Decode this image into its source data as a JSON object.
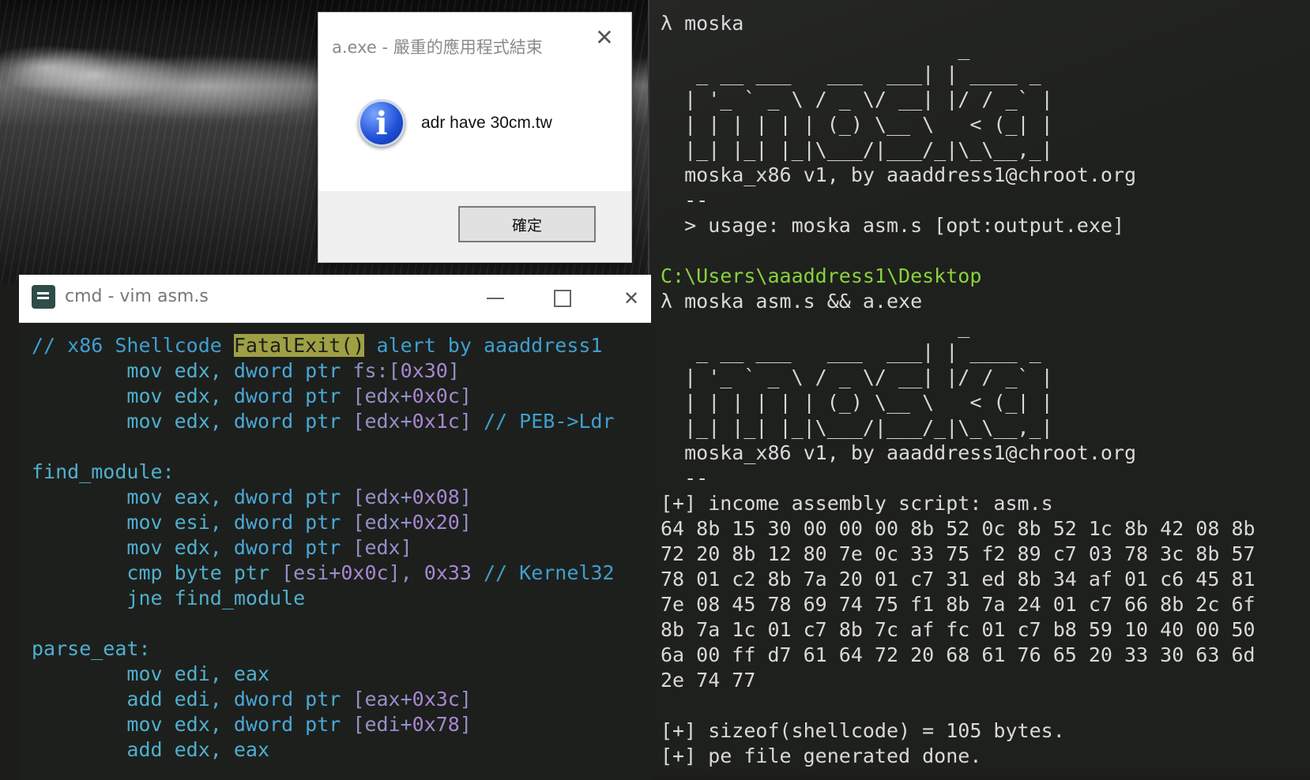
{
  "msgbox": {
    "title": "a.exe - 嚴重的應用程式結束",
    "close_label": "✕",
    "message": "adr have 30cm.tw",
    "ok_label": "確定",
    "icon": "info-icon"
  },
  "vim": {
    "title": "cmd - vim  asm.s",
    "lines": [
      {
        "parts": [
          [
            "c-cmt",
            "// x86 Shellcode "
          ],
          [
            "c-hl",
            "FatalExit()"
          ],
          [
            "c-cmt",
            " alert by aaaddress1"
          ]
        ]
      },
      {
        "parts": [
          [
            "",
            "        mov edx, "
          ],
          [
            "c-kw",
            "dword ptr"
          ],
          [
            "",
            "",
            " "
          ],
          [
            "c-br",
            " fs:["
          ],
          [
            "c-num",
            "0x30"
          ],
          [
            "c-br",
            "]"
          ]
        ]
      },
      {
        "parts": [
          [
            "",
            "        mov edx, "
          ],
          [
            "c-kw",
            "dword ptr "
          ],
          [
            "c-br",
            "[edx+"
          ],
          [
            "c-num",
            "0x0c"
          ],
          [
            "c-br",
            "]"
          ]
        ]
      },
      {
        "parts": [
          [
            "",
            "        mov edx, "
          ],
          [
            "c-kw",
            "dword ptr "
          ],
          [
            "c-br",
            "[edx+"
          ],
          [
            "c-num",
            "0x1c"
          ],
          [
            "c-br",
            "]"
          ],
          [
            "c-cmt",
            " // PEB->Ldr"
          ]
        ]
      },
      {
        "parts": [
          [
            "",
            ""
          ]
        ]
      },
      {
        "parts": [
          [
            "",
            "find_module:"
          ]
        ]
      },
      {
        "parts": [
          [
            "",
            "        mov eax, "
          ],
          [
            "c-kw",
            "dword ptr "
          ],
          [
            "c-br",
            "[edx+"
          ],
          [
            "c-num",
            "0x08"
          ],
          [
            "c-br",
            "]"
          ]
        ]
      },
      {
        "parts": [
          [
            "",
            "        mov esi, "
          ],
          [
            "c-kw",
            "dword ptr "
          ],
          [
            "c-br",
            "[edx+"
          ],
          [
            "c-num",
            "0x20"
          ],
          [
            "c-br",
            "]"
          ]
        ]
      },
      {
        "parts": [
          [
            "",
            "        mov edx, "
          ],
          [
            "c-kw",
            "dword ptr "
          ],
          [
            "c-br",
            "[edx]"
          ]
        ]
      },
      {
        "parts": [
          [
            "",
            "        cmp byte ptr "
          ],
          [
            "c-br",
            "[esi+"
          ],
          [
            "c-num",
            "0x0c"
          ],
          [
            "c-br",
            "], "
          ],
          [
            "c-num",
            "0x33"
          ],
          [
            "c-cmt",
            " // Kernel32"
          ]
        ]
      },
      {
        "parts": [
          [
            "",
            "        jne find_module"
          ]
        ]
      },
      {
        "parts": [
          [
            "",
            ""
          ]
        ]
      },
      {
        "parts": [
          [
            "",
            "parse_eat:"
          ]
        ]
      },
      {
        "parts": [
          [
            "",
            "        mov edi, eax"
          ]
        ]
      },
      {
        "parts": [
          [
            "",
            "        add edi, "
          ],
          [
            "c-kw",
            "dword ptr "
          ],
          [
            "c-br",
            "[eax+"
          ],
          [
            "c-num",
            "0x3c"
          ],
          [
            "c-br",
            "]"
          ]
        ]
      },
      {
        "parts": [
          [
            "",
            "        mov edx, "
          ],
          [
            "c-kw",
            "dword ptr "
          ],
          [
            "c-br",
            "[edi+"
          ],
          [
            "c-num",
            "0x78"
          ],
          [
            "c-br",
            "]"
          ]
        ]
      },
      {
        "parts": [
          [
            "",
            "        add edx, eax"
          ]
        ]
      }
    ]
  },
  "terminal": {
    "prompt1": "λ moska",
    "ascii_logo": "                         _\n   _ __ ___   ___  ___| | ____ _\n  | '_ ` _ \\ / _ \\/ __| |/ / _` |\n  | | | | | | (_) \\__ \\   < (_| |\n  |_| |_| |_|\\___/|___/_|\\_\\__,_|",
    "banner": "  moska_x86 v1, by aaaddress1@chroot.org",
    "sep": "  --",
    "usage": "  > usage: moska asm.s [opt:output.exe]",
    "path": "C:\\Users\\aaaddress1\\Desktop",
    "prompt2": "λ moska asm.s && a.exe",
    "income": "[+] income assembly script: asm.s",
    "hex": "64 8b 15 30 00 00 00 8b 52 0c 8b 52 1c 8b 42 08 8b\n72 20 8b 12 80 7e 0c 33 75 f2 89 c7 03 78 3c 8b 57\n78 01 c2 8b 7a 20 01 c7 31 ed 8b 34 af 01 c6 45 81\n7e 08 45 78 69 74 75 f1 8b 7a 24 01 c7 66 8b 2c 6f\n8b 7a 1c 01 c7 8b 7c af fc 01 c7 b8 59 10 40 00 50\n6a 00 ff d7 61 64 72 20 68 61 76 65 20 33 30 63 6d\n2e 74 77",
    "sizeof": "[+] sizeof(shellcode) = 105 bytes.",
    "done": "[+] pe file generated done."
  }
}
